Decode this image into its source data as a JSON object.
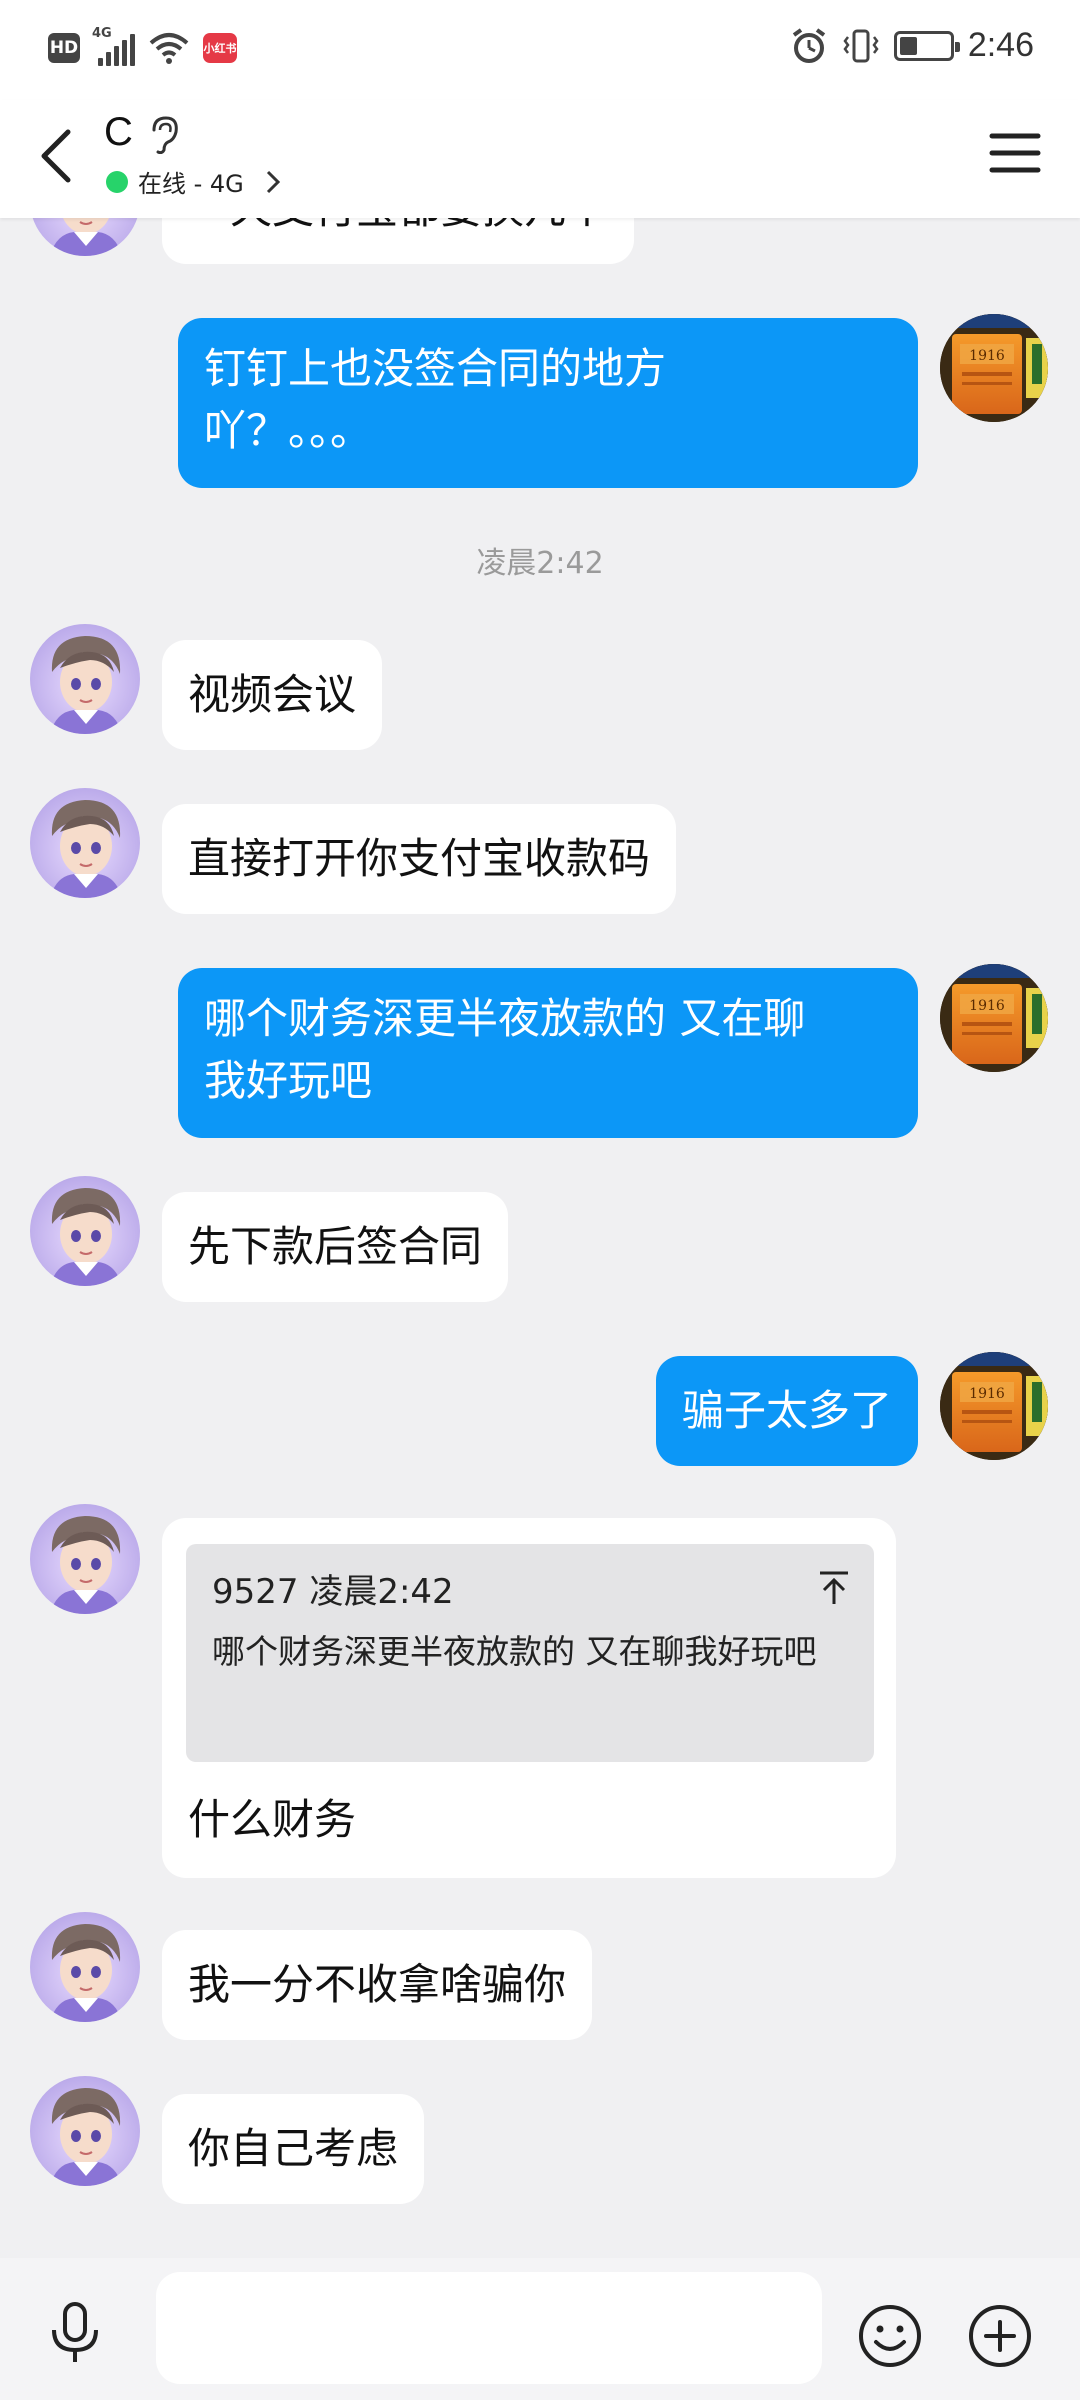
{
  "status_bar": {
    "hd": "HD",
    "network": "4G",
    "app_badge": "小红书",
    "time": "2:46",
    "battery_level": 0.35
  },
  "header": {
    "contact_name": "C",
    "status": "在线 - 4G"
  },
  "messages": {
    "partial_top": "一天支付宝都要换几个",
    "m1": "钉钉上也没签合同的地方",
    "m1b": "吖？。。。",
    "time_sep": "凌晨2:42",
    "m2": "视频会议",
    "m3": "直接打开你支付宝收款码",
    "m4a": "哪个财务深更半夜放款的 又在聊",
    "m4b": "我好玩吧",
    "m5": "先下款后签合同",
    "m6": "骗子太多了",
    "m7_quote_meta": "9527 凌晨2:42",
    "m7_quote_text": "哪个财务深更半夜放款的 又在聊我好玩吧",
    "m7_reply": "什么财务",
    "m8": "我一分不收拿啥骗你",
    "m9": "你自己考虑"
  },
  "input": {
    "placeholder": ""
  },
  "colors": {
    "outgoing_bubble": "#0c97f7",
    "incoming_bubble": "#ffffff",
    "chat_background": "#f0f0f2",
    "online_dot": "#27d36a"
  },
  "icons": [
    "back-arrow-icon",
    "ear-icon",
    "chevron-right-icon",
    "menu-icon",
    "microphone-icon",
    "emoji-icon",
    "plus-icon",
    "scroll-to-quote-icon",
    "alarm-icon",
    "vibrate-icon",
    "wifi-icon",
    "signal-icon",
    "battery-icon"
  ]
}
